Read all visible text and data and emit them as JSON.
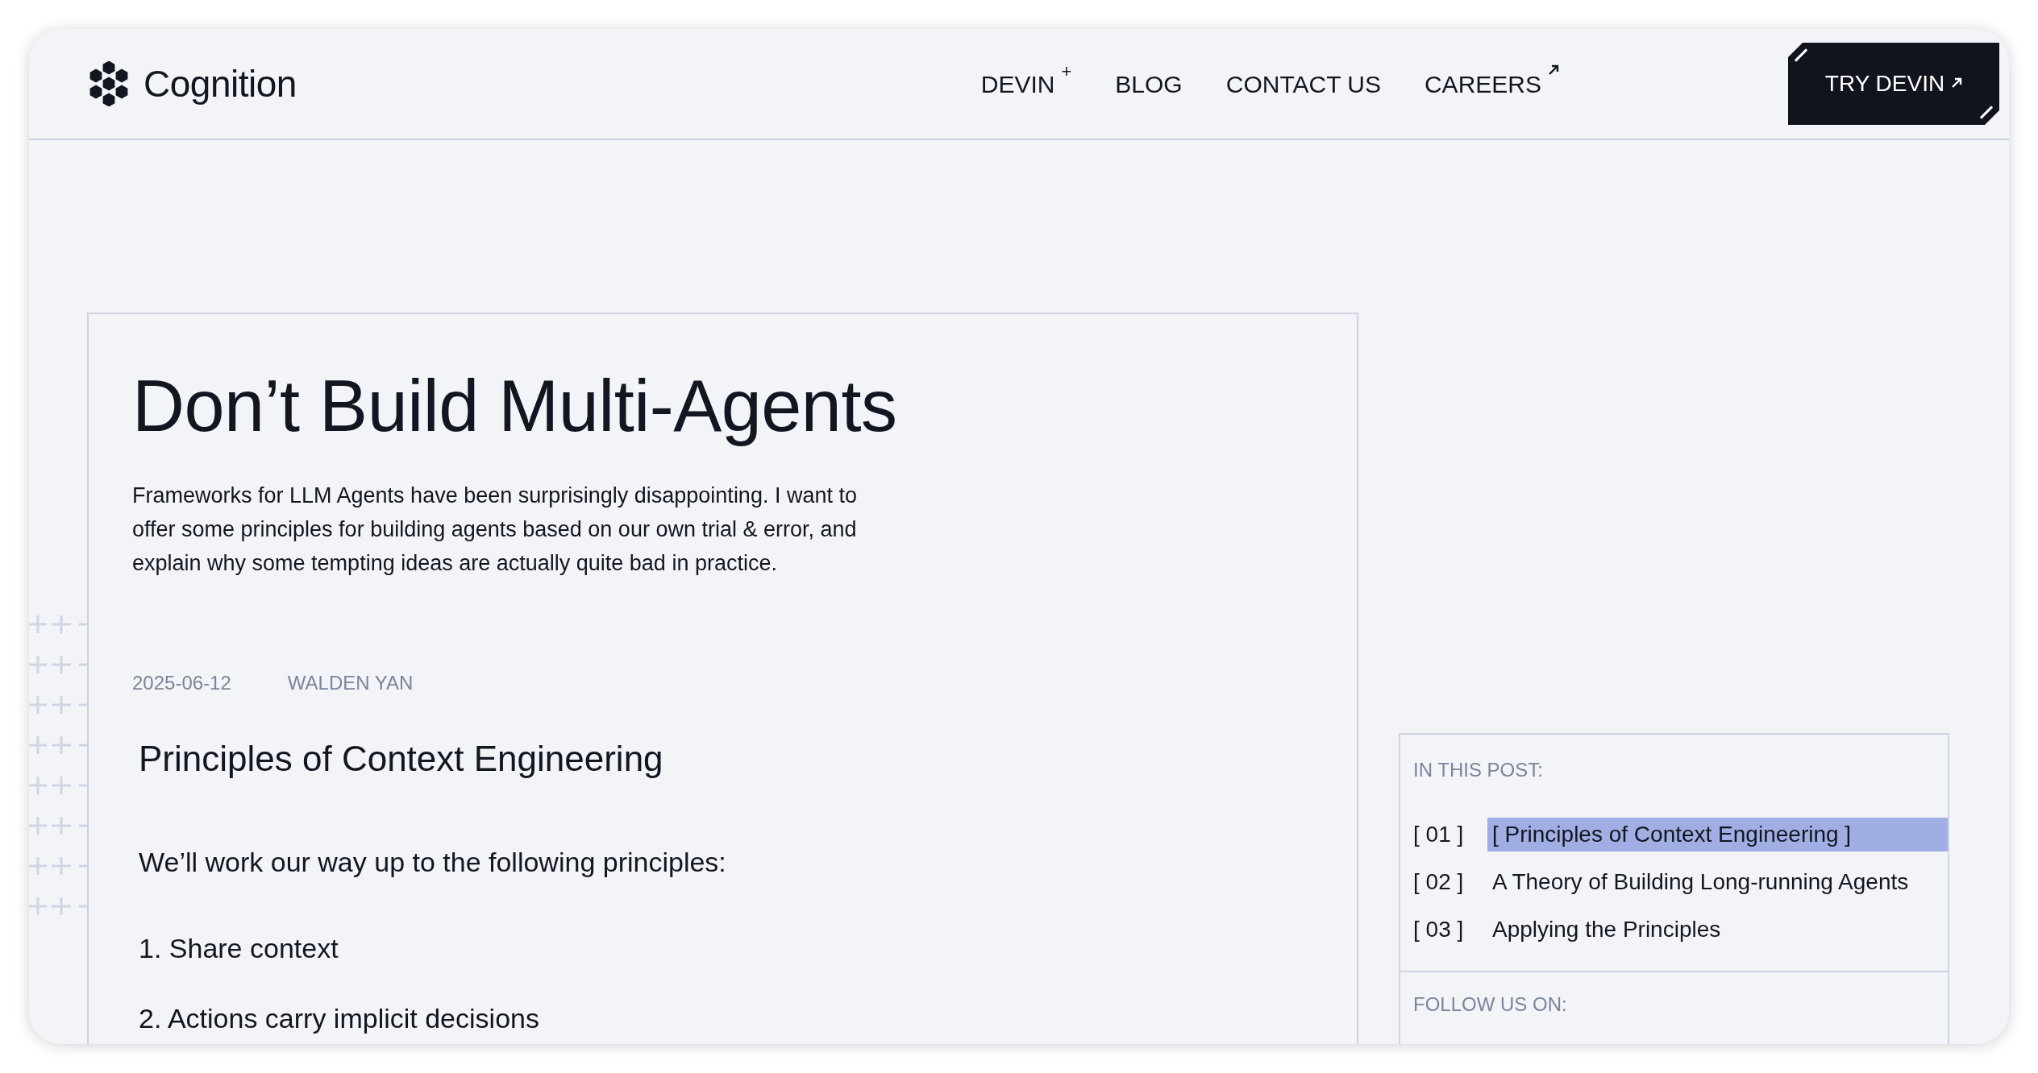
{
  "header": {
    "logo_text": "Cognition",
    "nav": [
      {
        "label": "DEVIN",
        "mark": "+",
        "external": false
      },
      {
        "label": "BLOG",
        "external": false
      },
      {
        "label": "CONTACT US",
        "external": false
      },
      {
        "label": "CAREERS",
        "external": true
      }
    ],
    "cta": {
      "label": "TRY DEVIN",
      "external": true
    }
  },
  "article": {
    "title": "Don’t Build Multi-Agents",
    "summary": "Frameworks for LLM Agents have been surprisingly disappointing. I want to offer some principles for building agents based on our own trial & error, and explain why some tempting ideas are actually quite bad in practice.",
    "date": "2025-06-12",
    "author": "WALDEN YAN",
    "section_heading": "Principles of Context Engineering",
    "intro": "We’ll work our way up to the following principles:",
    "list": [
      "1. Share context",
      "2. Actions carry implicit decisions"
    ]
  },
  "sidebar": {
    "toc_heading": "IN THIS POST:",
    "toc": [
      {
        "number": "[ 01 ]",
        "label": "[ Principles of Context Engineering ]",
        "selected": true
      },
      {
        "number": "[ 02 ]",
        "label": "A Theory of Building Long-running Agents",
        "selected": false
      },
      {
        "number": "[ 03 ]",
        "label": "Applying the Principles",
        "selected": false
      }
    ],
    "follow_heading": "FOLLOW US ON:"
  }
}
